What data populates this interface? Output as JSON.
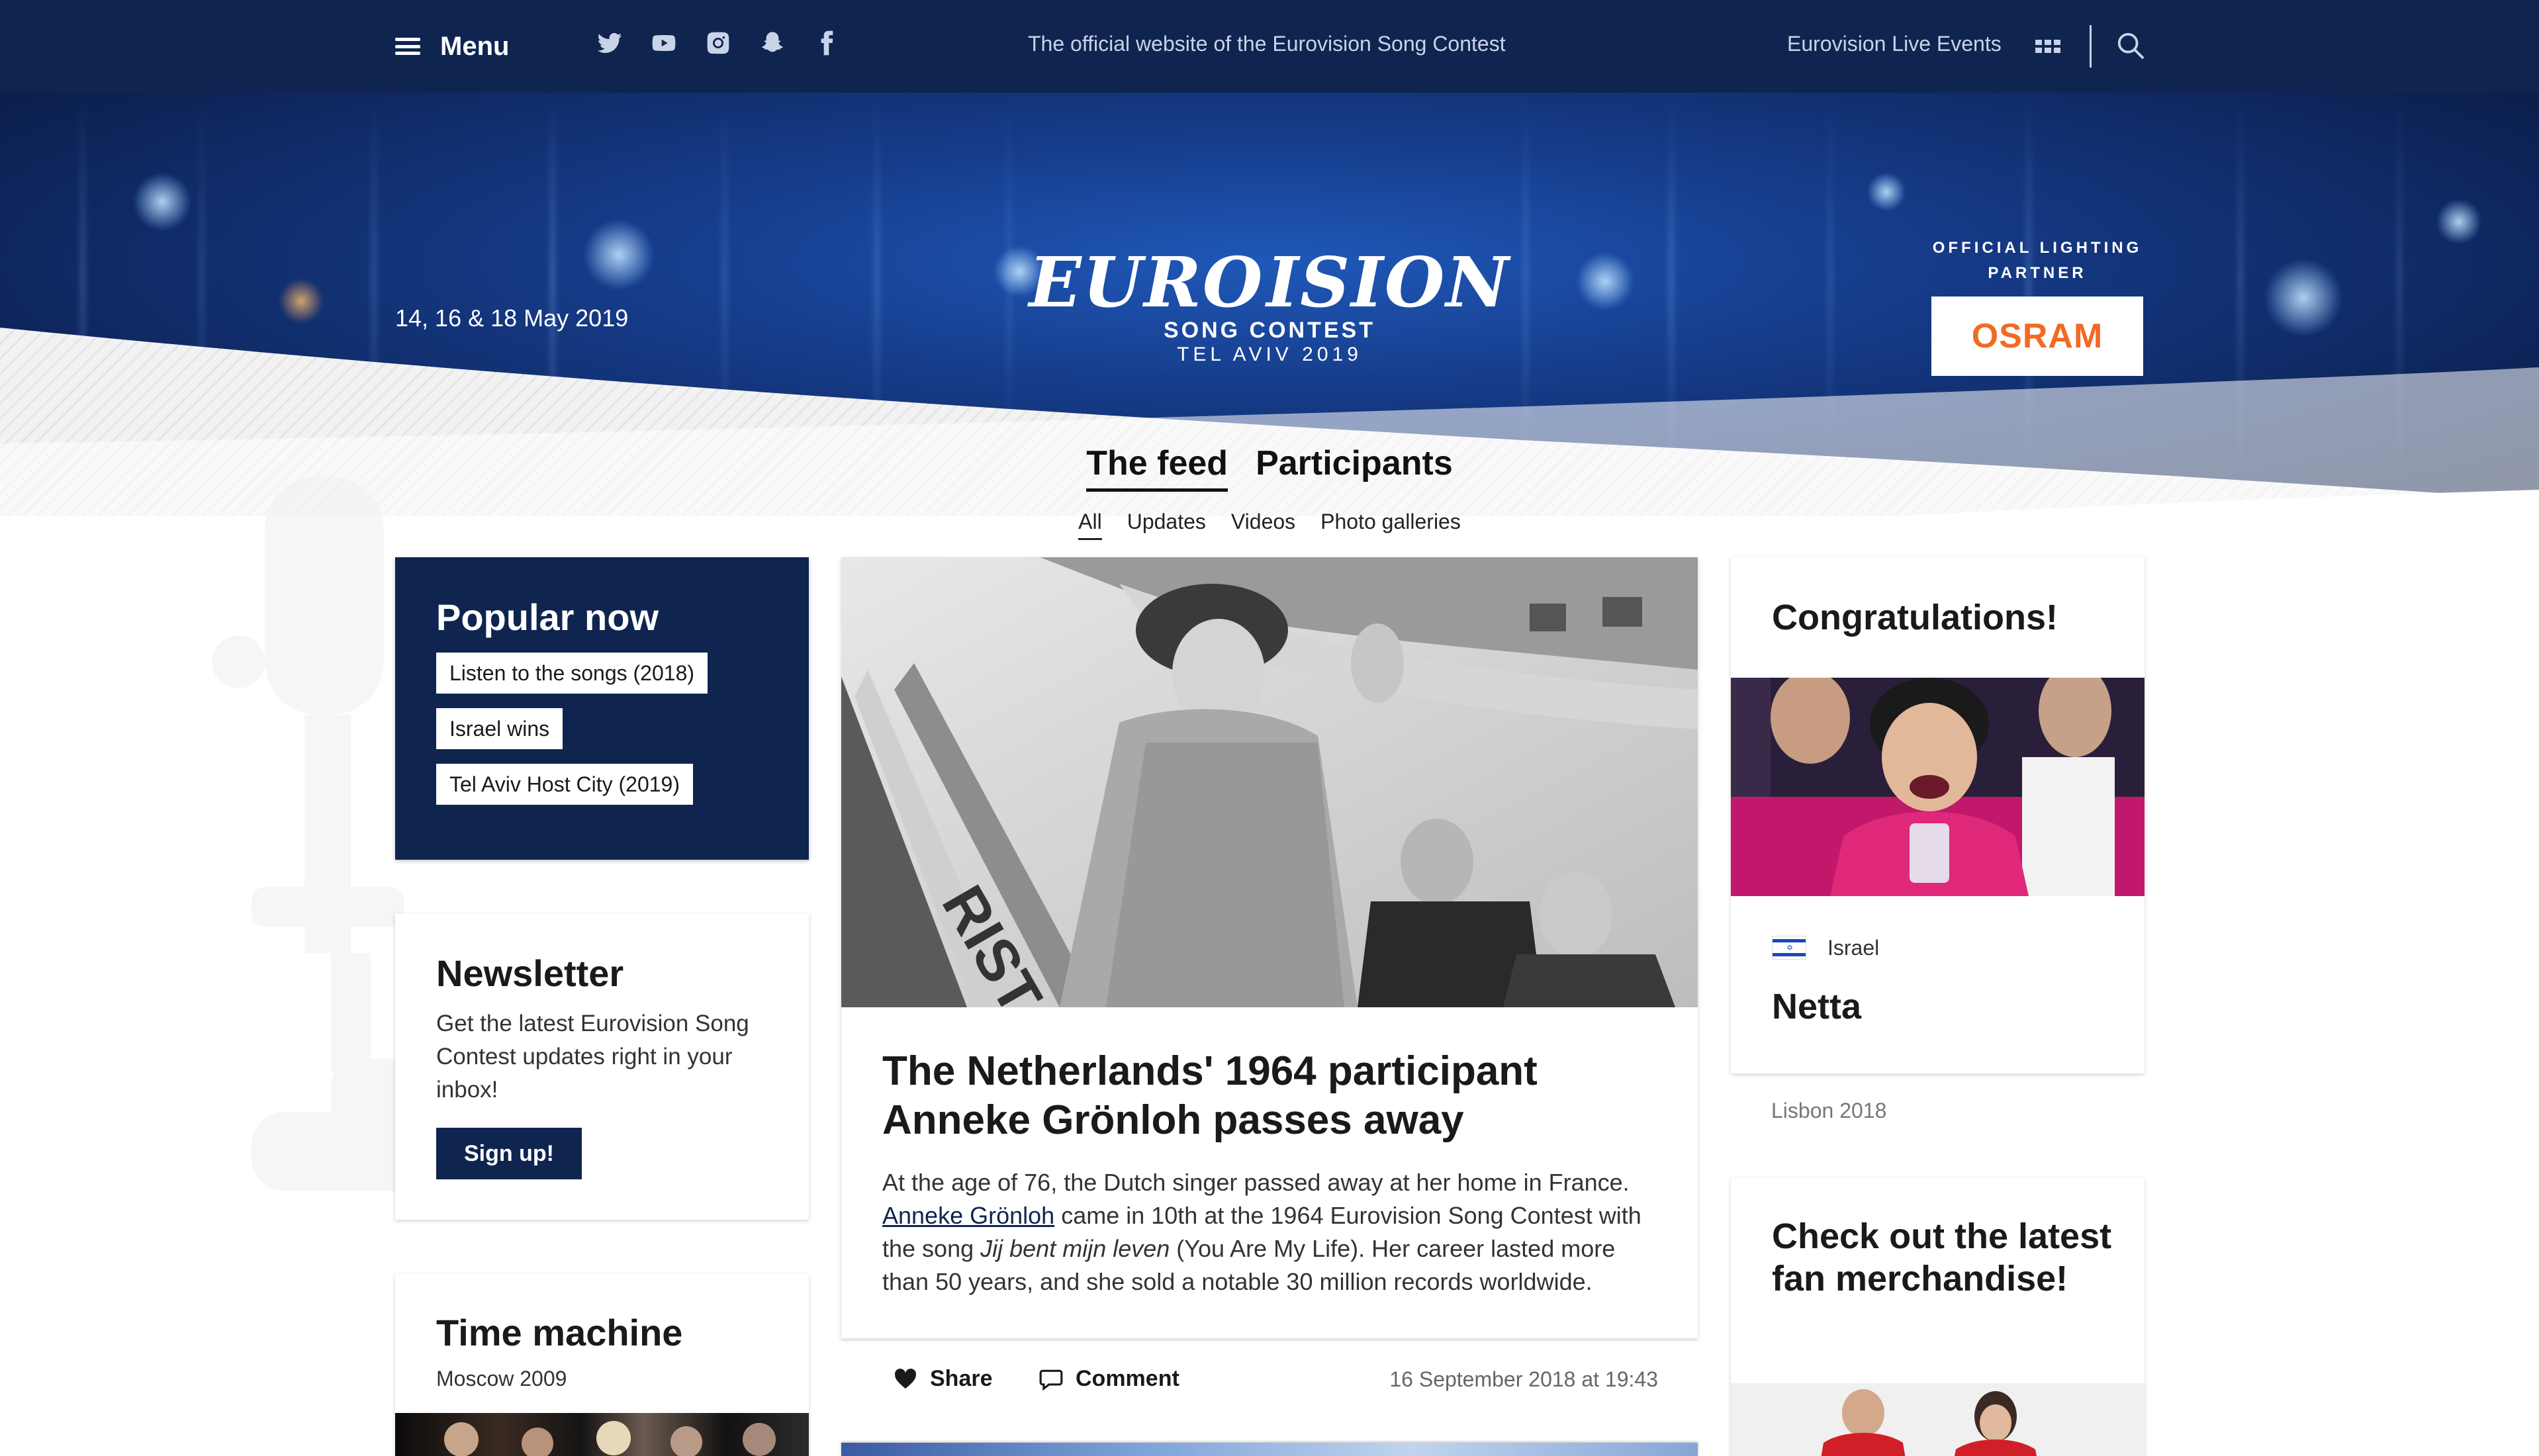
{
  "topbar": {
    "menu_label": "Menu",
    "socials": [
      "twitter-icon",
      "youtube-icon",
      "instagram-icon",
      "snapchat-icon",
      "facebook-icon"
    ],
    "tagline": "The official website of the Eurovision Song Contest",
    "live_events": "Eurovision Live Events"
  },
  "hero": {
    "dates": "14, 16 & 18 May 2019",
    "logo": {
      "word_left": "EURO",
      "word_right": "ISION",
      "sub1": "SONG CONTEST",
      "sub2": "TEL AVIV 2019"
    },
    "partner_label": "OFFICIAL LIGHTING PARTNER",
    "partner_name": "OSRAM"
  },
  "tabs": {
    "main": [
      {
        "label": "The feed",
        "active": true
      },
      {
        "label": "Participants",
        "active": false
      }
    ],
    "sub": [
      {
        "label": "All",
        "active": true
      },
      {
        "label": "Updates",
        "active": false
      },
      {
        "label": "Videos",
        "active": false
      },
      {
        "label": "Photo galleries",
        "active": false
      }
    ]
  },
  "popular": {
    "title": "Popular now",
    "items": [
      "Listen to the songs (2018)",
      "Israel wins",
      "Tel Aviv Host City (2019)"
    ]
  },
  "newsletter": {
    "title": "Newsletter",
    "text": "Get the latest Eurovision Song Contest updates right in your inbox!",
    "button": "Sign up!"
  },
  "timemachine": {
    "title": "Time machine",
    "subtitle": "Moscow 2009"
  },
  "article": {
    "title": "The Netherlands' 1964 participant Anneke Grönloh passes away",
    "body_intro": "At the age of 76, the Dutch singer passed away at her home in France.",
    "body_link": "Anneke Grönloh",
    "body_mid": "came in 10th at the 1964 Eurovision Song Contest with the song",
    "body_song": "Jij bent mijn leven",
    "body_end": "(You Are My Life). Her career lasted more than 50 years, and she sold a notable 30 million records worldwide.",
    "share": "Share",
    "comment": "Comment",
    "date": "16 September 2018 at 19:43"
  },
  "congrats": {
    "title": "Congratulations!",
    "country": "Israel",
    "artist": "Netta",
    "footer": "Lisbon 2018"
  },
  "merch": {
    "title": "Check out the latest fan merchandise!"
  },
  "colors": {
    "navy": "#0f2550",
    "osram_orange": "#f26a21"
  }
}
